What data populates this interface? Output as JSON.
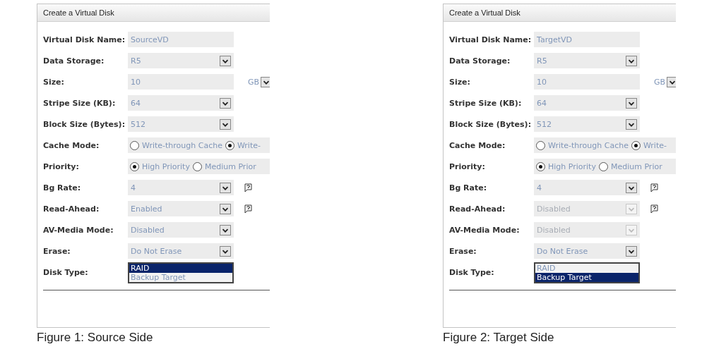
{
  "figures": [
    {
      "title": "Create a Virtual Disk",
      "caption": "Figure 1: Source Side",
      "rows": [
        {
          "kind": "text",
          "label": "Virtual Disk Name:",
          "value": "SourceVD"
        },
        {
          "kind": "select",
          "label": "Data Storage:",
          "value": "R5",
          "disabled": false
        },
        {
          "kind": "select_unit",
          "label": "Size:",
          "value": "10",
          "unit": "GB"
        },
        {
          "kind": "select",
          "label": "Stripe Size (KB):",
          "value": "64",
          "disabled": false
        },
        {
          "kind": "select",
          "label": "Block Size (Bytes):",
          "value": "512",
          "disabled": false
        },
        {
          "kind": "radio",
          "label": "Cache Mode:",
          "options": [
            {
              "label": "Write-through Cache",
              "selected": false
            },
            {
              "label": "Write-",
              "selected": true
            }
          ]
        },
        {
          "kind": "radio",
          "label": "Priority:",
          "options": [
            {
              "label": "High Priority",
              "selected": true
            },
            {
              "label": "Medium Prior",
              "selected": false
            }
          ]
        },
        {
          "kind": "select",
          "label": "Bg Rate:",
          "value": "4",
          "disabled": false,
          "help": true
        },
        {
          "kind": "select",
          "label": "Read-Ahead:",
          "value": "Enabled",
          "disabled": false,
          "help": true
        },
        {
          "kind": "select",
          "label": "AV-Media Mode:",
          "value": "Disabled",
          "disabled": false
        },
        {
          "kind": "select",
          "label": "Erase:",
          "value": "Do Not Erase",
          "disabled": false
        },
        {
          "kind": "list",
          "label": "Disk Type:",
          "options": [
            {
              "label": "RAID",
              "selected": true
            },
            {
              "label": "Backup Target",
              "selected": false
            }
          ]
        }
      ]
    },
    {
      "title": "Create a Virtual Disk",
      "caption": "Figure 2: Target Side",
      "rows": [
        {
          "kind": "text",
          "label": "Virtual Disk Name:",
          "value": "TargetVD"
        },
        {
          "kind": "select",
          "label": "Data Storage:",
          "value": "R5",
          "disabled": false
        },
        {
          "kind": "select_unit",
          "label": "Size:",
          "value": "10",
          "unit": "GB"
        },
        {
          "kind": "select",
          "label": "Stripe Size (KB):",
          "value": "64",
          "disabled": false
        },
        {
          "kind": "select",
          "label": "Block Size (Bytes):",
          "value": "512",
          "disabled": false
        },
        {
          "kind": "radio",
          "label": "Cache Mode:",
          "options": [
            {
              "label": "Write-through Cache",
              "selected": false
            },
            {
              "label": "Write-",
              "selected": true
            }
          ]
        },
        {
          "kind": "radio",
          "label": "Priority:",
          "options": [
            {
              "label": "High Priority",
              "selected": true
            },
            {
              "label": "Medium Prior",
              "selected": false
            }
          ]
        },
        {
          "kind": "select",
          "label": "Bg Rate:",
          "value": "4",
          "disabled": false,
          "help": true
        },
        {
          "kind": "select",
          "label": "Read-Ahead:",
          "value": "Disabled",
          "disabled": true,
          "help": true
        },
        {
          "kind": "select",
          "label": "AV-Media Mode:",
          "value": "Disabled",
          "disabled": true
        },
        {
          "kind": "select",
          "label": "Erase:",
          "value": "Do Not Erase",
          "disabled": false
        },
        {
          "kind": "list",
          "label": "Disk Type:",
          "options": [
            {
              "label": "RAID",
              "selected": false
            },
            {
              "label": "Backup Target",
              "selected": true
            }
          ]
        }
      ]
    }
  ]
}
